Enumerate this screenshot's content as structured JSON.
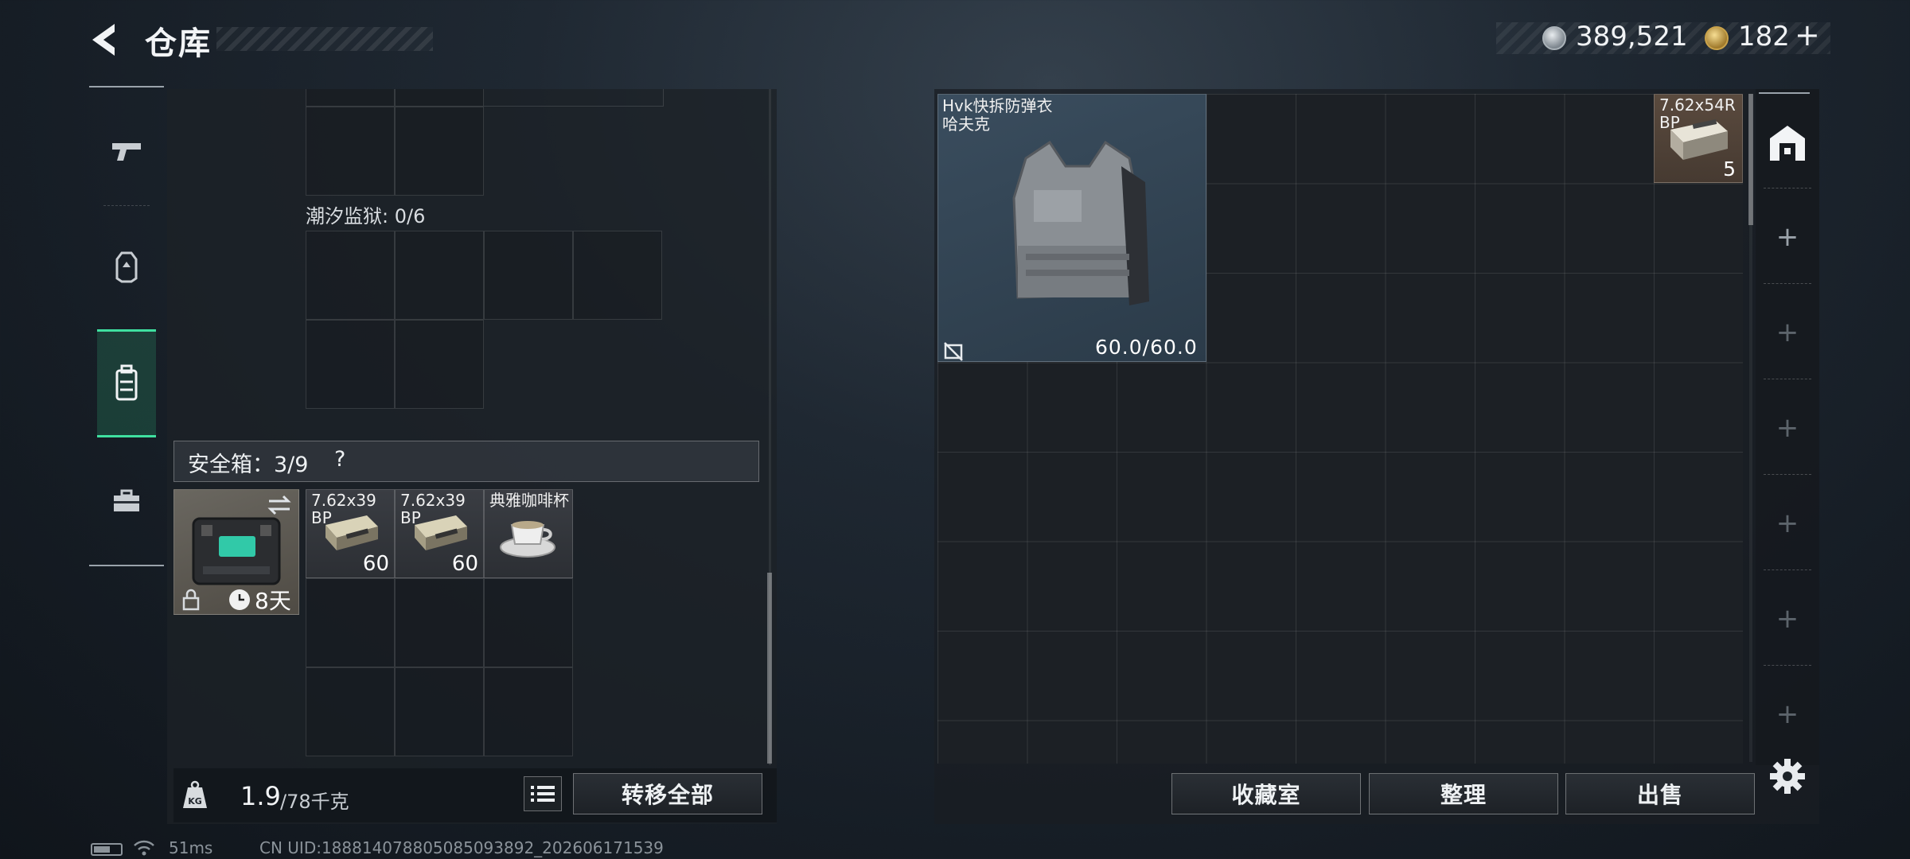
{
  "header": {
    "title": "仓库",
    "currency_silver": "389,521",
    "currency_gold": "182",
    "add_label": "+"
  },
  "rail": {
    "items": [
      {
        "name": "weapons",
        "icon": "pistol-icon"
      },
      {
        "name": "armor",
        "icon": "helmet-icon"
      },
      {
        "name": "gear",
        "icon": "backpack-icon",
        "active": true
      },
      {
        "name": "tools",
        "icon": "toolbox-icon"
      }
    ],
    "accent_color": "#3fe0a0"
  },
  "left": {
    "container_label": "潮汐监狱: 0/6",
    "safebox_label": "安全箱：3/9",
    "safebox_help": "?",
    "safebox_timer": "8天",
    "items": [
      {
        "name": "7.62x39\nBP",
        "count": "60"
      },
      {
        "name": "7.62x39\nBP",
        "count": "60"
      },
      {
        "name": "典雅咖啡杯",
        "count": ""
      }
    ],
    "weight_current": "1.9",
    "weight_max": "/78千克",
    "transfer_all": "转移全部"
  },
  "right": {
    "vest_name": "Hvk快拆防弹衣\n哈夫克",
    "vest_durability": "60.0/60.0",
    "ammo_name": "7.62x54R\nBP",
    "ammo_count": "5",
    "btn_collection": "收藏室",
    "btn_sort": "整理",
    "btn_sell": "出售",
    "side_add": "+"
  },
  "footer": {
    "ping": "51ms",
    "uid": "CN UID:188814078805085093892_202606171539"
  }
}
